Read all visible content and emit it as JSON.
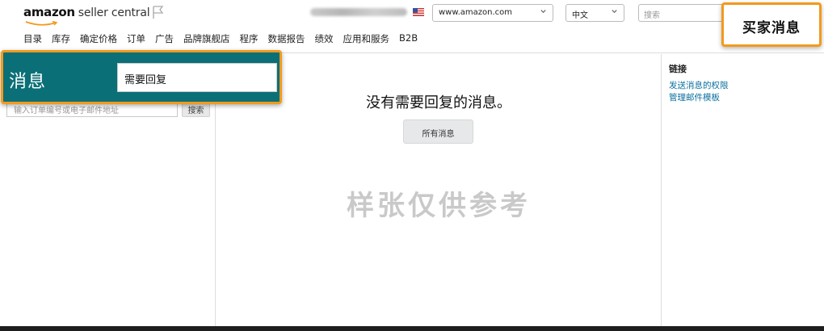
{
  "header": {
    "logo_brand": "amazon",
    "logo_text": "seller central",
    "account_name": "",
    "marketplace": "www.amazon.com",
    "language": "中文",
    "search_placeholder": "搜索"
  },
  "nav": {
    "items": [
      "目录",
      "库存",
      "确定价格",
      "订单",
      "广告",
      "品牌旗舰店",
      "程序",
      "数据报告",
      "绩效",
      "应用和服务",
      "B2B"
    ]
  },
  "left": {
    "order_placeholder": "输入订单编号或电子邮件地址",
    "search_button": "搜索"
  },
  "messages_callout": {
    "title": "消息",
    "filter_value": "需要回复"
  },
  "main": {
    "empty_text": "没有需要回复的消息。",
    "all_messages_button": "所有消息",
    "watermark": "样张仅供参考"
  },
  "right": {
    "links_title": "链接",
    "links": [
      "发送消息的权限",
      "管理邮件模板"
    ]
  },
  "buyer_callout": {
    "label": "买家消息"
  },
  "colors": {
    "accent_teal": "#0b6f77",
    "callout_orange": "#f29a1c",
    "link_blue": "#0b6f9e"
  }
}
